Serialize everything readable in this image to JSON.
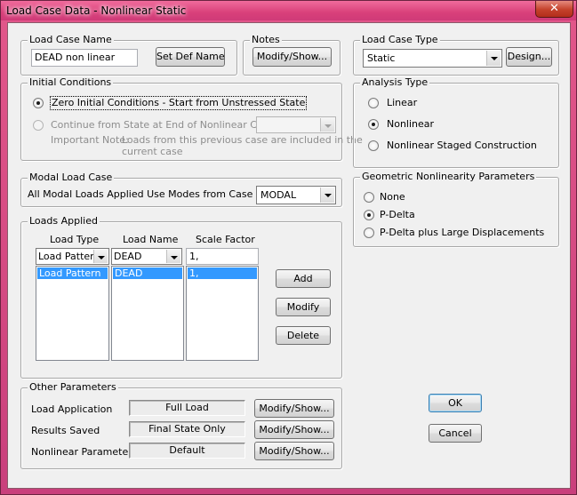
{
  "window": {
    "title": "Load Case Data - Nonlinear Static",
    "close_label": "✕"
  },
  "load_case_name": {
    "legend": "Load Case Name",
    "value": "DEAD non linear",
    "set_def_label": "Set Def Name"
  },
  "notes": {
    "legend": "Notes",
    "button": "Modify/Show..."
  },
  "load_case_type": {
    "legend": "Load Case Type",
    "value": "Static",
    "design_button": "Design..."
  },
  "initial_conditions": {
    "legend": "Initial Conditions",
    "option_zero": "Zero Initial Conditions - Start from Unstressed State",
    "option_continue": "Continue from State at End of Nonlinear Case",
    "continue_case_value": "",
    "note_label": "Important Note:",
    "note_line1": "Loads from this previous case are included in the",
    "note_line2": "current case"
  },
  "analysis_type": {
    "legend": "Analysis Type",
    "options": [
      "Linear",
      "Nonlinear",
      "Nonlinear Staged Construction"
    ],
    "selected": "Nonlinear"
  },
  "geometric_nonlinearity": {
    "legend": "Geometric Nonlinearity Parameters",
    "options": [
      "None",
      "P-Delta",
      "P-Delta plus Large Displacements"
    ],
    "selected": "P-Delta"
  },
  "modal_load_case": {
    "legend": "Modal Load Case",
    "label": "All Modal Loads Applied Use Modes from Case",
    "value": "MODAL"
  },
  "loads_applied": {
    "legend": "Loads Applied",
    "headers": {
      "type": "Load Type",
      "name": "Load Name",
      "factor": "Scale Factor"
    },
    "edit_row": {
      "type": "Load Patterr",
      "name": "DEAD",
      "factor": "1,"
    },
    "rows": [
      {
        "type": "Load Pattern",
        "name": "DEAD",
        "factor": "1,"
      }
    ],
    "add_button": "Add",
    "modify_button": "Modify",
    "delete_button": "Delete"
  },
  "other_parameters": {
    "legend": "Other Parameters",
    "load_application": {
      "label": "Load Application",
      "value": "Full Load",
      "button": "Modify/Show..."
    },
    "results_saved": {
      "label": "Results Saved",
      "value": "Final State Only",
      "button": "Modify/Show..."
    },
    "nonlinear_parameters": {
      "label": "Nonlinear Parameters",
      "value": "Default",
      "button": "Modify/Show..."
    }
  },
  "dialog_buttons": {
    "ok": "OK",
    "cancel": "Cancel"
  }
}
